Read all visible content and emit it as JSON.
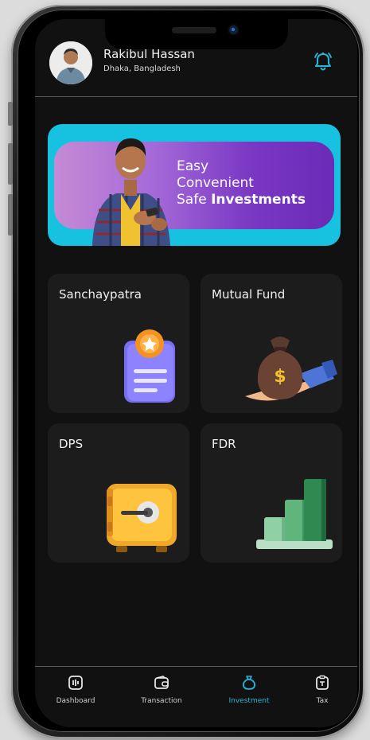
{
  "user": {
    "name": "Rakibul Hassan",
    "location": "Dhaka, Bangladesh"
  },
  "banner": {
    "line1": "Easy",
    "line2": "Convenient",
    "line3_prefix": "Safe ",
    "line3_bold": "Investments"
  },
  "cards": [
    {
      "title": "Sanchaypatra",
      "icon": "certificate-icon"
    },
    {
      "title": "Mutual Fund",
      "icon": "money-bag-icon"
    },
    {
      "title": "DPS",
      "icon": "safe-icon"
    },
    {
      "title": "FDR",
      "icon": "bar-growth-icon"
    }
  ],
  "nav": {
    "items": [
      {
        "label": "Dashboard",
        "icon": "dashboard-icon"
      },
      {
        "label": "Transaction",
        "icon": "wallet-icon"
      },
      {
        "label": "Investment",
        "icon": "investment-bag-icon",
        "active": true
      },
      {
        "label": "Tax",
        "icon": "tax-icon"
      }
    ]
  },
  "colors": {
    "screen_bg": "#111111",
    "card_bg": "#1c1c1c",
    "accent": "#22b6d8",
    "banner_bg": "#16c2e0",
    "banner_plate": "#7a38c3"
  }
}
